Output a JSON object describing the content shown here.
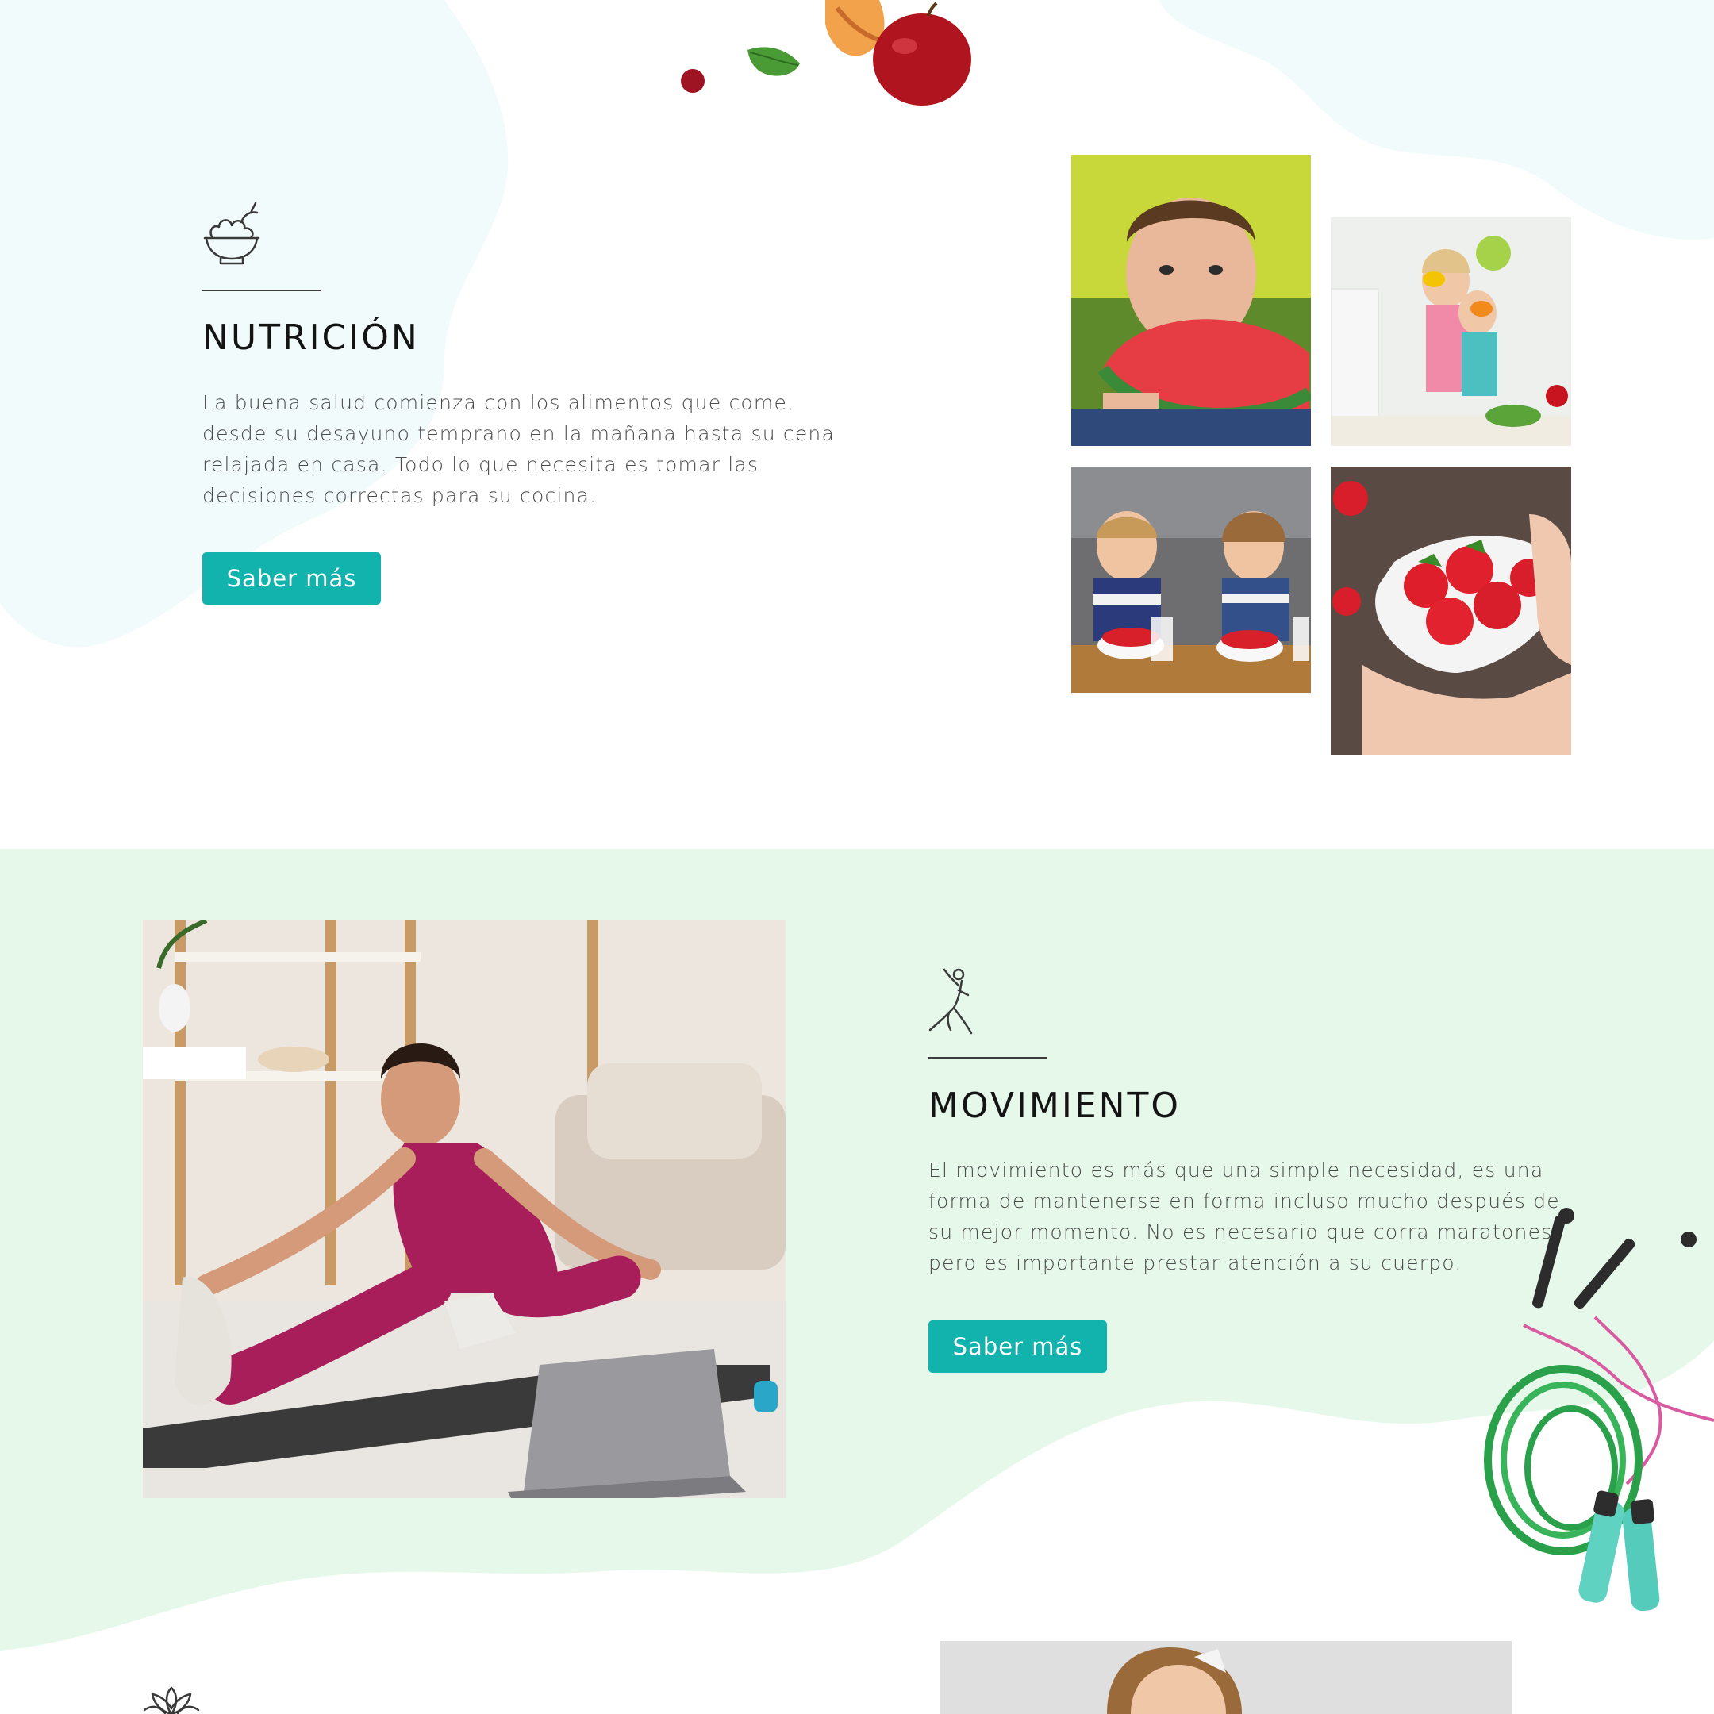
{
  "colors": {
    "accent": "#12b3ad",
    "mint_band": "#e5f8ea",
    "soft_blob": "#f1fbfb",
    "title": "#141414",
    "body_text": "#4b4b4b"
  },
  "nutrition": {
    "icon": "salad-bowl-icon",
    "title": "NUTRICIÓN",
    "text": "La buena salud comienza con los alimentos que come, desde su desayuno temprano en la mañana hasta su cena relajada en casa. Todo lo que necesita es tomar las decisiones correctas para su cocina.",
    "button_label": "Saber más",
    "photos": [
      "boy-eating-watermelon-photo",
      "mother-daughter-peppers-photo",
      "kids-eating-strawberries-photo",
      "bowl-of-strawberries-photo"
    ]
  },
  "movement": {
    "icon": "stretching-figure-icon",
    "title": "MOVIMIENTO",
    "text": "El movimiento es más que una simple necesidad, es una forma de mantenerse en forma incluso mucho después de su mejor momento. No es necesario que corra maratones, pero es importante prestar atención a su cuerpo.",
    "button_label": "Saber más",
    "photo": "woman-stretching-on-mat-photo",
    "decoration": "jump-rope-illustration"
  },
  "next_section": {
    "icon": "lotus-icon",
    "photo": "girl-portrait-photo"
  },
  "decorations": {
    "top": "fruit-illustration"
  }
}
